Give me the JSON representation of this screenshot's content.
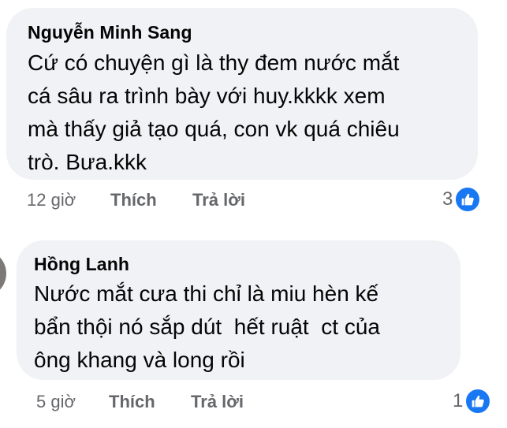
{
  "comments": [
    {
      "author": "Nguyễn Minh Sang",
      "lines": [
        "Cứ có chuyện gì là thy đem nước mắt",
        "cá sâu ra trình bày với huy.kkkk xem",
        "mà thấy giả tạo quá, con vk quá chiêu",
        "trò. Bưa.kkk"
      ],
      "time": "12 giờ",
      "like_label": "Thích",
      "reply_label": "Trả lời",
      "reaction_count": "3",
      "reaction_icon": "like-icon"
    },
    {
      "author": "Hồng Lanh",
      "lines": [
        "Nước mắt cưa thi chỉ là miu hèn kế",
        "bẩn thội nó sắp dút  hết ruật  ct của",
        "ông khang và long rồi"
      ],
      "time": "5 giờ",
      "like_label": "Thích",
      "reply_label": "Trả lời",
      "reaction_count": "1",
      "reaction_icon": "like-icon"
    }
  ],
  "colors": {
    "bubble": "#f0f2f5",
    "meta": "#65676b",
    "like": "#1877f2"
  }
}
